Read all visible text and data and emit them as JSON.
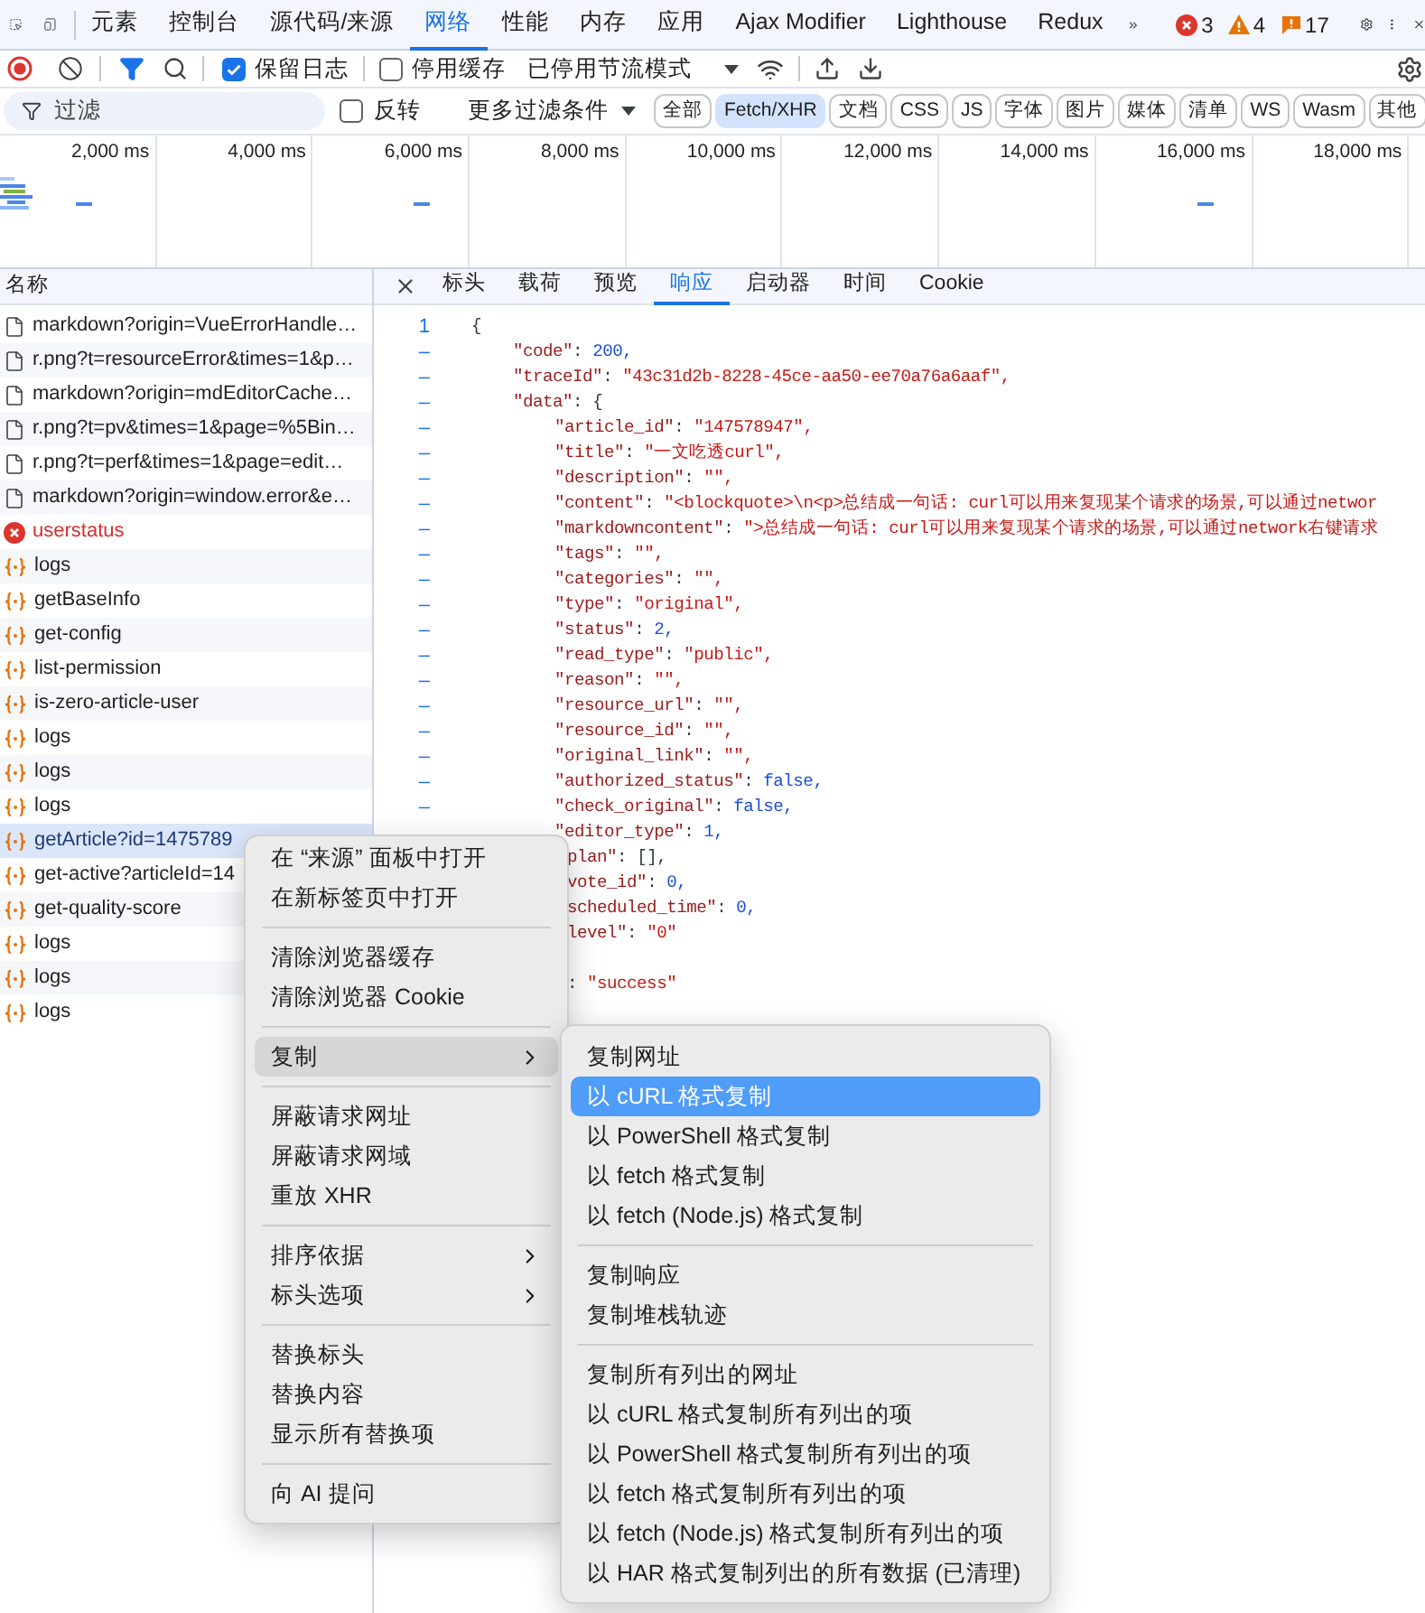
{
  "panel_tabs": [
    {
      "label": "元素",
      "selected": false
    },
    {
      "label": "控制台",
      "selected": false
    },
    {
      "label": "源代码/来源",
      "selected": false
    },
    {
      "label": "网络",
      "selected": true
    },
    {
      "label": "性能",
      "selected": false
    },
    {
      "label": "内存",
      "selected": false
    },
    {
      "label": "应用",
      "selected": false
    },
    {
      "label": "Ajax Modifier",
      "selected": false
    },
    {
      "label": "Lighthouse",
      "selected": false
    },
    {
      "label": "Redux",
      "selected": false
    }
  ],
  "issue_counts": [
    {
      "kind": "error",
      "count": "3"
    },
    {
      "kind": "warning",
      "count": "4"
    },
    {
      "kind": "info",
      "count": "17"
    }
  ],
  "network_toolbar": {
    "preserve_log": {
      "label": "保留日志",
      "checked": true
    },
    "disable_cache": {
      "label": "停用缓存",
      "checked": false
    },
    "throttling": "已停用节流模式"
  },
  "filter_bar": {
    "placeholder": "过滤",
    "invert": {
      "label": "反转",
      "checked": false
    },
    "more_filters": "更多过滤条件",
    "types": [
      {
        "label": "全部",
        "selected": false
      },
      {
        "label": "Fetch/XHR",
        "selected": true
      },
      {
        "label": "文档",
        "selected": false
      },
      {
        "label": "CSS",
        "selected": false
      },
      {
        "label": "JS",
        "selected": false
      },
      {
        "label": "字体",
        "selected": false
      },
      {
        "label": "图片",
        "selected": false
      },
      {
        "label": "媒体",
        "selected": false
      },
      {
        "label": "清单",
        "selected": false
      },
      {
        "label": "WS",
        "selected": false
      },
      {
        "label": "Wasm",
        "selected": false
      },
      {
        "label": "其他",
        "selected": false
      }
    ]
  },
  "timeline": {
    "ticks": [
      "2,000 ms",
      "4,000 ms",
      "6,000 ms",
      "8,000 ms",
      "10,000 ms",
      "12,000 ms",
      "14,000 ms",
      "16,000 ms",
      "18,000 ms"
    ]
  },
  "request_list": {
    "header": "名称",
    "rows": [
      {
        "kind": "document",
        "name": "markdown?origin=VueErrorHandle…",
        "selected": false
      },
      {
        "kind": "document",
        "name": "r.png?t=resourceError&times=1&p…",
        "selected": false
      },
      {
        "kind": "document",
        "name": "markdown?origin=mdEditorCache…",
        "selected": false
      },
      {
        "kind": "document",
        "name": "r.png?t=pv&times=1&page=%5Bin…",
        "selected": false
      },
      {
        "kind": "document",
        "name": "r.png?t=perf&times=1&page=edit…",
        "selected": false
      },
      {
        "kind": "document",
        "name": "markdown?origin=window.error&e…",
        "selected": false
      },
      {
        "kind": "error",
        "name": "userstatus",
        "selected": false
      },
      {
        "kind": "fetch",
        "name": "logs",
        "selected": false
      },
      {
        "kind": "fetch",
        "name": "getBaseInfo",
        "selected": false
      },
      {
        "kind": "fetch",
        "name": "get-config",
        "selected": false
      },
      {
        "kind": "fetch",
        "name": "list-permission",
        "selected": false
      },
      {
        "kind": "fetch",
        "name": "is-zero-article-user",
        "selected": false
      },
      {
        "kind": "fetch",
        "name": "logs",
        "selected": false
      },
      {
        "kind": "fetch",
        "name": "logs",
        "selected": false
      },
      {
        "kind": "fetch",
        "name": "logs",
        "selected": false
      },
      {
        "kind": "fetch",
        "name": "getArticle?id=1475789",
        "selected": true
      },
      {
        "kind": "fetch",
        "name": "get-active?articleId=14",
        "selected": false
      },
      {
        "kind": "fetch",
        "name": "get-quality-score",
        "selected": false
      },
      {
        "kind": "fetch",
        "name": "logs",
        "selected": false
      },
      {
        "kind": "fetch",
        "name": "logs",
        "selected": false
      },
      {
        "kind": "fetch",
        "name": "logs",
        "selected": false
      }
    ]
  },
  "detail_tabs": [
    {
      "label": "标头",
      "selected": false
    },
    {
      "label": "载荷",
      "selected": false
    },
    {
      "label": "预览",
      "selected": false
    },
    {
      "label": "响应",
      "selected": true
    },
    {
      "label": "启动器",
      "selected": false
    },
    {
      "label": "时间",
      "selected": false
    },
    {
      "label": "Cookie",
      "selected": false
    }
  ],
  "response_lines": [
    {
      "gutter": "1",
      "kind": "root",
      "text": "{"
    },
    {
      "gutter": "–",
      "kind": "field",
      "text": "\"code\": 200,"
    },
    {
      "gutter": "–",
      "kind": "field",
      "text": "\"traceId\": \"43c31d2b-8228-45ce-aa50-ee70a76a6aaf\","
    },
    {
      "gutter": "–",
      "kind": "field",
      "text": "\"data\": {"
    },
    {
      "gutter": "–",
      "kind": "subfield",
      "text": "\"article_id\": \"147578947\","
    },
    {
      "gutter": "–",
      "kind": "subfield",
      "text": "\"title\": \"一文吃透curl\","
    },
    {
      "gutter": "–",
      "kind": "subfield",
      "text": "\"description\": \"\","
    },
    {
      "gutter": "–",
      "kind": "subfield",
      "text": "\"content\": \"<blockquote>\\n<p>总结成一句话: curl可以用来复现某个请求的场景,可以通过networ"
    },
    {
      "gutter": "–",
      "kind": "subfield",
      "text": "\"markdowncontent\": \">总结成一句话: curl可以用来复现某个请求的场景,可以通过network右键请求"
    },
    {
      "gutter": "–",
      "kind": "subfield",
      "text": "\"tags\": \"\","
    },
    {
      "gutter": "–",
      "kind": "subfield",
      "text": "\"categories\": \"\","
    },
    {
      "gutter": "–",
      "kind": "subfield",
      "text": "\"type\": \"original\","
    },
    {
      "gutter": "–",
      "kind": "subfield",
      "text": "\"status\": 2,"
    },
    {
      "gutter": "–",
      "kind": "subfield",
      "text": "\"read_type\": \"public\","
    },
    {
      "gutter": "–",
      "kind": "subfield",
      "text": "\"reason\": \"\","
    },
    {
      "gutter": "–",
      "kind": "subfield",
      "text": "\"resource_url\": \"\","
    },
    {
      "gutter": "–",
      "kind": "subfield",
      "text": "\"resource_id\": \"\","
    },
    {
      "gutter": "–",
      "kind": "subfield",
      "text": "\"original_link\": \"\","
    },
    {
      "gutter": "–",
      "kind": "subfield",
      "text": "\"authorized_status\": false,"
    },
    {
      "gutter": "–",
      "kind": "subfield",
      "text": "\"check_original\": false,"
    },
    {
      "kind": "subfield",
      "text": "\"editor_type\": 1,"
    },
    {
      "kind": "covered",
      "text": "plan\": [],"
    },
    {
      "kind": "covered",
      "text": "vote_id\": 0,"
    },
    {
      "kind": "covered",
      "text": "scheduled_time\": 0,"
    },
    {
      "kind": "covered",
      "text": "level\": \"0\""
    },
    {
      "kind": "hidden"
    },
    {
      "kind": "covered",
      "text": ": \"success\""
    }
  ],
  "context_menu": {
    "groups": [
      [
        {
          "label": "在 “来源” 面板中打开",
          "submenu": false,
          "selected": false
        },
        {
          "label": "在新标签页中打开",
          "submenu": false,
          "selected": false
        }
      ],
      [
        {
          "label": "清除浏览器缓存",
          "submenu": false,
          "selected": false
        },
        {
          "label": "清除浏览器 Cookie",
          "submenu": false,
          "selected": false
        }
      ],
      [
        {
          "label": "复制",
          "submenu": true,
          "selected": true
        }
      ],
      [
        {
          "label": "屏蔽请求网址",
          "submenu": false,
          "selected": false
        },
        {
          "label": "屏蔽请求网域",
          "submenu": false,
          "selected": false
        },
        {
          "label": "重放 XHR",
          "submenu": false,
          "selected": false
        }
      ],
      [
        {
          "label": "排序依据",
          "submenu": true,
          "selected": false
        },
        {
          "label": "标头选项",
          "submenu": true,
          "selected": false
        }
      ],
      [
        {
          "label": "替换标头",
          "submenu": false,
          "selected": false
        },
        {
          "label": "替换内容",
          "submenu": false,
          "selected": false
        },
        {
          "label": "显示所有替换项",
          "submenu": false,
          "selected": false
        }
      ],
      [
        {
          "label": "向 AI 提问",
          "submenu": false,
          "selected": false
        }
      ]
    ]
  },
  "copy_submenu": {
    "groups": [
      [
        {
          "label": "复制网址",
          "submenu": false,
          "selected": false
        },
        {
          "label": "以 cURL 格式复制",
          "submenu": false,
          "selected": true
        },
        {
          "label": "以 PowerShell 格式复制",
          "submenu": false,
          "selected": false
        },
        {
          "label": "以 fetch 格式复制",
          "submenu": false,
          "selected": false
        },
        {
          "label": "以 fetch (Node.js) 格式复制",
          "submenu": false,
          "selected": false
        }
      ],
      [
        {
          "label": "复制响应",
          "submenu": false,
          "selected": false
        },
        {
          "label": "复制堆栈轨迹",
          "submenu": false,
          "selected": false
        }
      ],
      [
        {
          "label": "复制所有列出的网址",
          "submenu": false,
          "selected": false
        },
        {
          "label": "以 cURL 格式复制所有列出的项",
          "submenu": false,
          "selected": false
        },
        {
          "label": "以 PowerShell 格式复制所有列出的项",
          "submenu": false,
          "selected": false
        },
        {
          "label": "以 fetch 格式复制所有列出的项",
          "submenu": false,
          "selected": false
        },
        {
          "label": "以 fetch (Node.js) 格式复制所有列出的项",
          "submenu": false,
          "selected": false
        },
        {
          "label": "以 HAR 格式复制列出的所有数据 (已清理)",
          "submenu": false,
          "selected": false
        }
      ]
    ]
  }
}
